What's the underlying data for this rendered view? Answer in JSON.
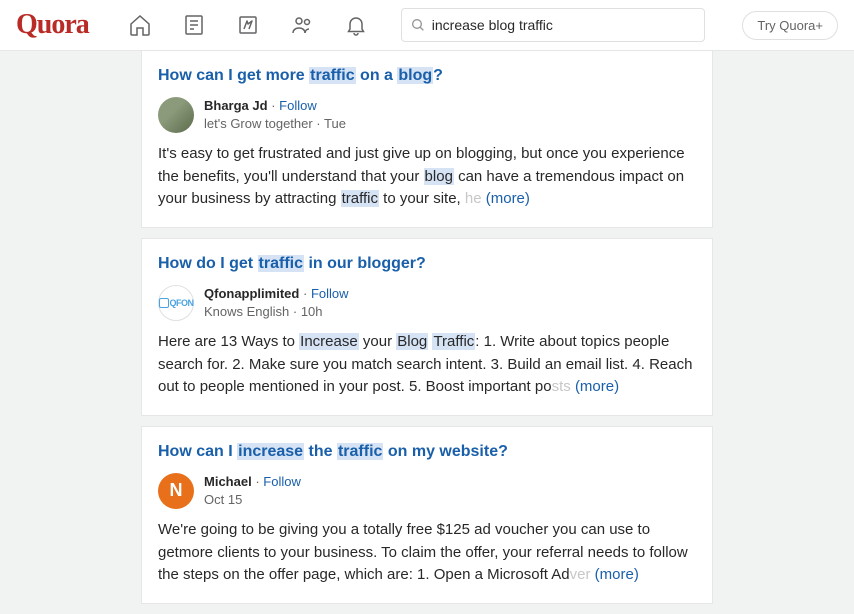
{
  "header": {
    "logo": "Quora",
    "search_value": "increase blog traffic",
    "try_button": "Try Quora+"
  },
  "results": [
    {
      "title_parts": [
        "How can I get more ",
        "traffic",
        " on a ",
        "blog",
        "?"
      ],
      "author": "Bharga Jd",
      "follow": "Follow",
      "subline": "let's Grow together · Tue",
      "body_parts": [
        "It's easy to get frustrated and just give up on blogging, but once you experience the benefits, you'll understand that your ",
        "blog",
        " can have a tremendous impact on your business by attracting ",
        "traffic",
        " to your site,"
      ],
      "fade": " he",
      "more": "(more)",
      "avatar_class": "avatar-img1",
      "avatar_letter": ""
    },
    {
      "title_parts": [
        "How do I get ",
        "traffic",
        " in our blogger?"
      ],
      "author": "Qfonapplimited",
      "follow": "Follow",
      "subline": "Knows English · 10h",
      "body_parts": [
        "Here are 13 Ways to ",
        "Increase",
        " your ",
        "Blog",
        " ",
        "Traffic",
        ": 1. Write about topics people search for. 2. Make sure you match search intent. 3. Build an email list. 4. Reach out to people mentioned in your post. 5. Boost important po"
      ],
      "fade": "sts",
      "more": "(more)",
      "avatar_class": "avatar-img2",
      "avatar_letter": "",
      "avatar_qfon": true
    },
    {
      "title_parts": [
        "How can I ",
        "increase",
        " the ",
        "traffic",
        " on my website?"
      ],
      "author": "Michael",
      "follow": "Follow",
      "subline": "Oct 15",
      "body_parts": [
        "We're going to be giving you a totally free $125 ad voucher you can use to getmore clients to your business. To claim the offer, your referral needs to follow the steps on the offer page, which are: 1. Open a Microsoft Ad"
      ],
      "fade": "ver",
      "more": "(more)",
      "avatar_class": "avatar-orange",
      "avatar_letter": "N"
    }
  ]
}
